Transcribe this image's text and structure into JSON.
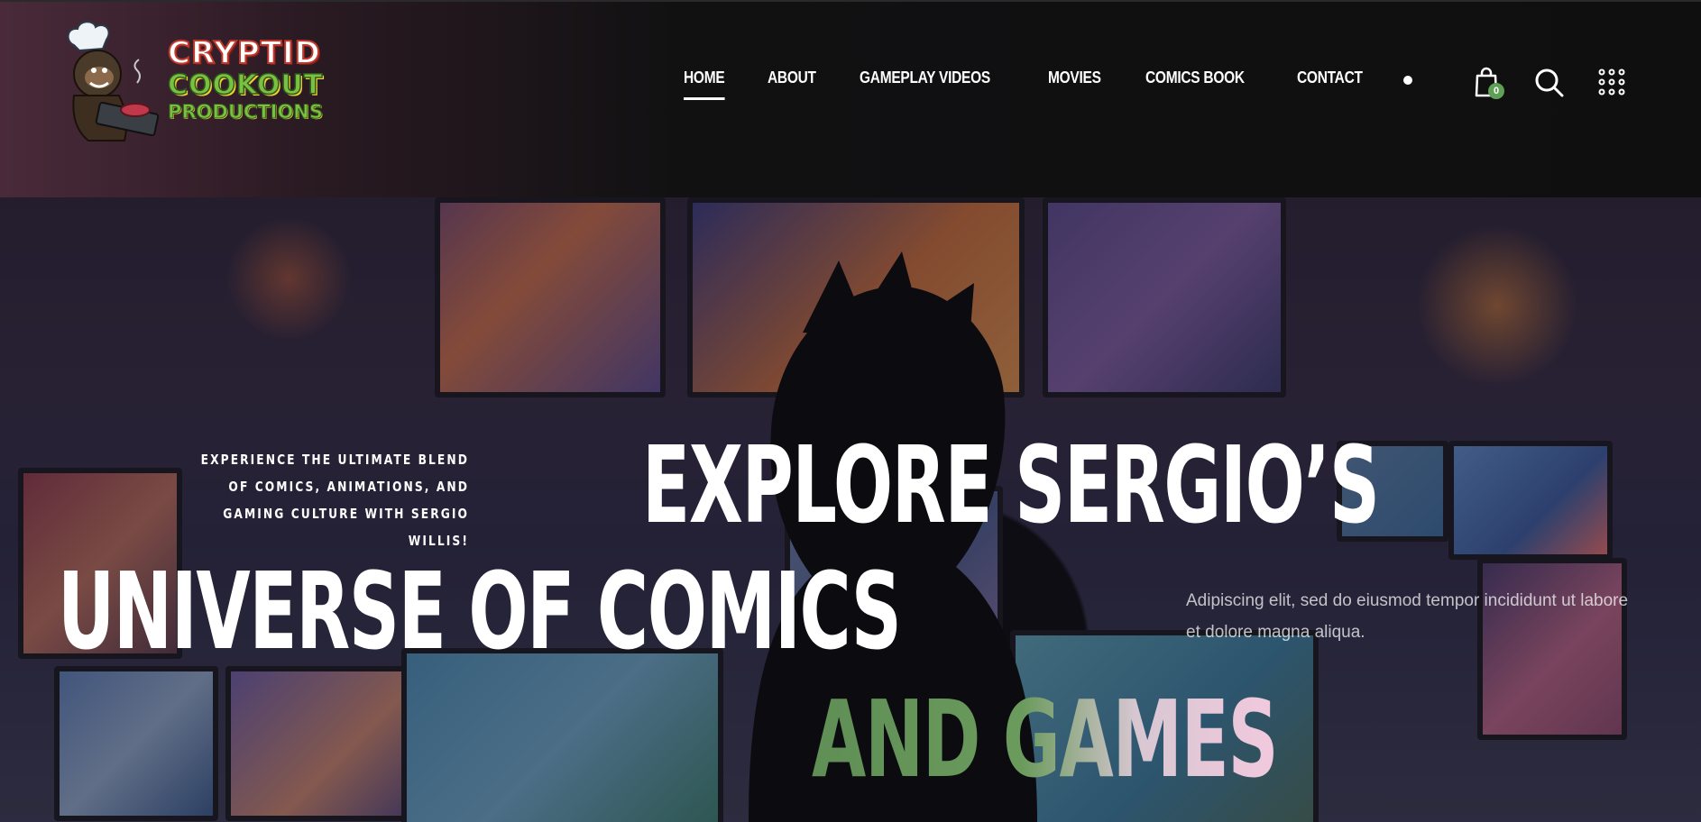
{
  "brand": {
    "logo_line1": "CRYPTID",
    "logo_line2": "COOKOUT",
    "logo_line3": "PRODUCTIONS"
  },
  "nav": {
    "items": [
      {
        "label": "HOME",
        "active": true
      },
      {
        "label": "ABOUT",
        "active": false
      },
      {
        "label": "GAMEPLAY VIDEOS",
        "active": false
      },
      {
        "label": "MOVIES",
        "active": false
      },
      {
        "label": "COMICS BOOK",
        "active": false
      },
      {
        "label": "CONTACT",
        "active": false
      }
    ]
  },
  "header_icons": {
    "cart_count": "0",
    "icons": [
      "dot-icon",
      "shopping-bag-icon",
      "search-icon",
      "grid-menu-icon"
    ],
    "badge_color": "#5fa057"
  },
  "hero": {
    "tagline": "EXPERIENCE THE ULTIMATE BLEND OF COMICS, ANIMATIONS, AND GAMING CULTURE WITH SERGIO WILLIS!",
    "headline_line1": "EXPLORE SERGIO’S",
    "headline_line2": "UNIVERSE OF COMICS",
    "headline_line3": "AND GAMES",
    "description": "Adipiscing elit, sed do eiusmod tempor incididunt ut labore et dolore magna aliqua.",
    "accent_green": "#5f8f55",
    "accent_pink": "#f2c9de"
  }
}
